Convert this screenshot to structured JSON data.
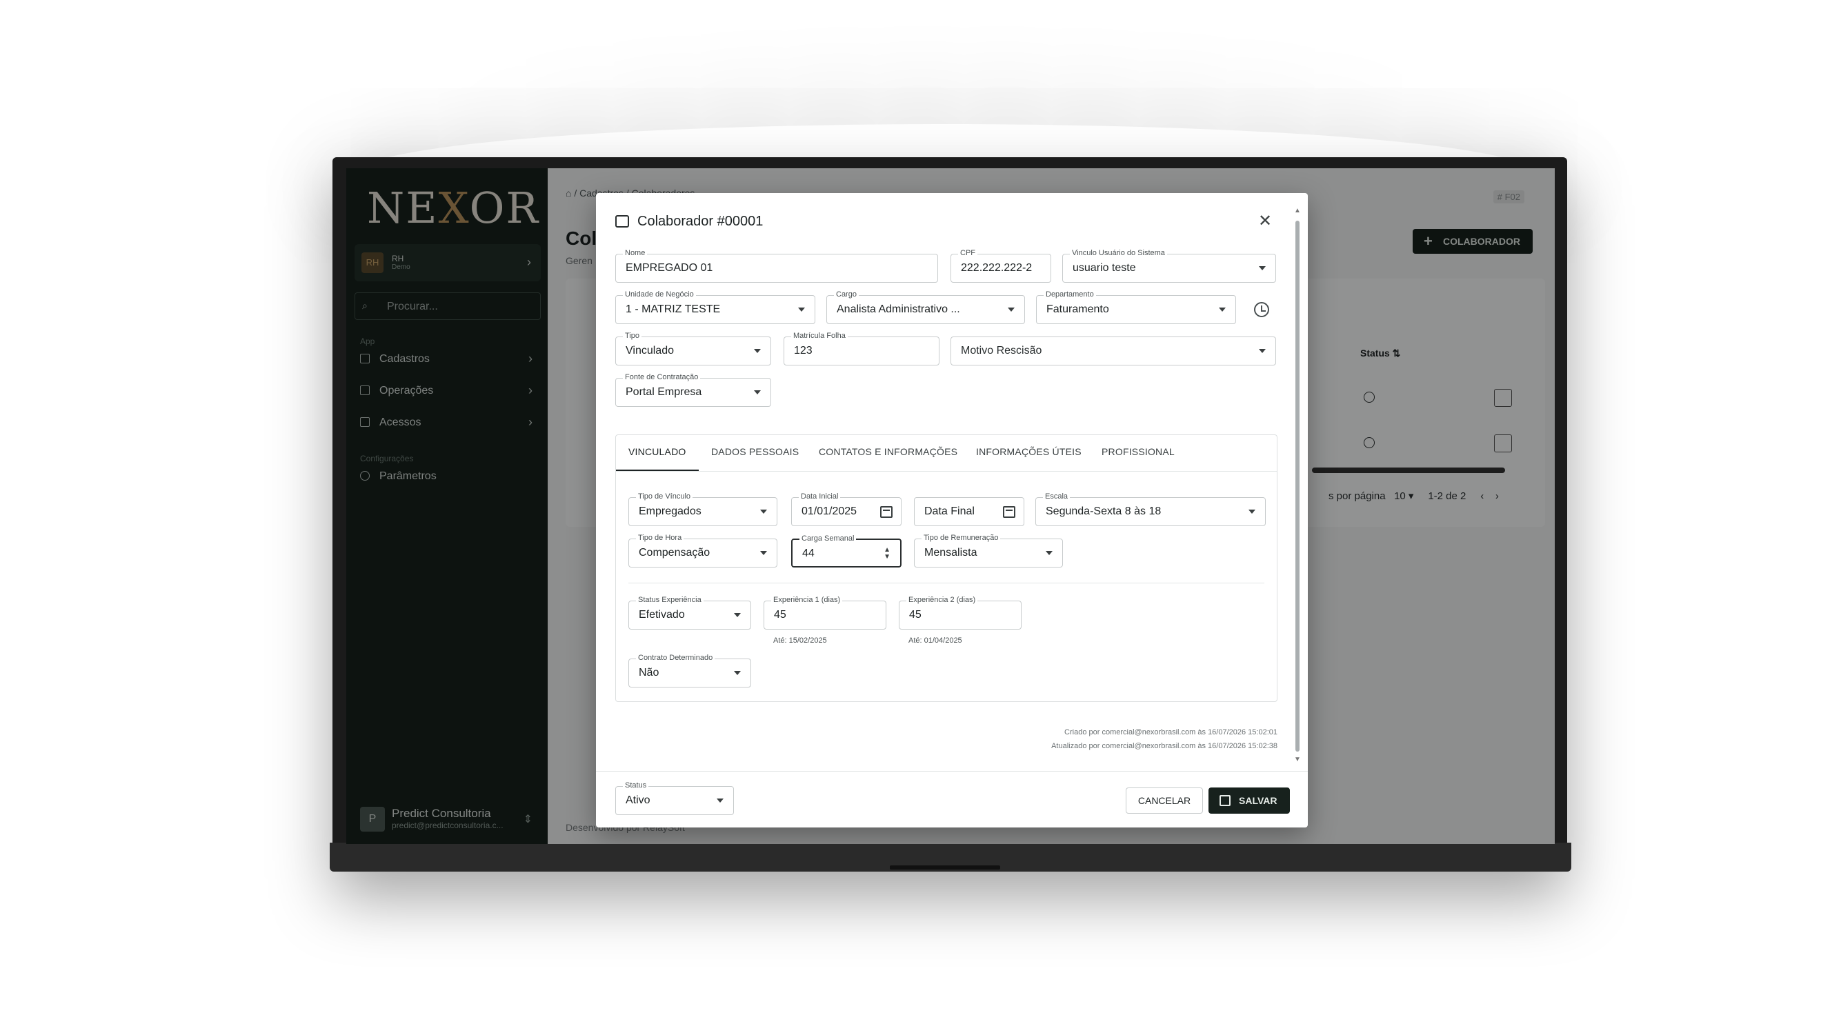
{
  "sidebar": {
    "logo": "NEXOR",
    "org": {
      "avatar": "RH",
      "name": "RH",
      "sub": "Demo"
    },
    "search_placeholder": "Procurar...",
    "section_app": "App",
    "items_app": [
      {
        "label": "Cadastros"
      },
      {
        "label": "Operações"
      },
      {
        "label": "Acessos"
      }
    ],
    "section_config": "Configurações",
    "items_config": [
      {
        "label": "Parâmetros"
      }
    ],
    "user": {
      "avatar": "P",
      "name": "Predict Consultoria",
      "email": "predict@predictconsultoria.c..."
    }
  },
  "background": {
    "breadcrumb": "⌂ /  Cadastros / Colaboradores",
    "tag": "# F02",
    "title": "Col",
    "subtitle": "Geren",
    "add_button": "COLABORADOR",
    "status_header": "Status ⇅",
    "rows_per_page_label": "s por página",
    "rows_per_page": "10",
    "range": "1-2 de 2",
    "footer": "Desenvolvido por RelaySoft"
  },
  "modal": {
    "title": "Colaborador #00001",
    "fields": {
      "nome": {
        "label": "Nome",
        "value": "EMPREGADO 01"
      },
      "cpf": {
        "label": "CPF",
        "value": "222.222.222-2"
      },
      "vinculo_usuario": {
        "label": "Vinculo Usuário do Sistema",
        "value": "usuario teste"
      },
      "unidade": {
        "label": "Unidade de Negócio",
        "value": "1 - MATRIZ TESTE"
      },
      "cargo": {
        "label": "Cargo",
        "value": "Analista Administrativo ..."
      },
      "departamento": {
        "label": "Departamento",
        "value": "Faturamento"
      },
      "tipo": {
        "label": "Tipo",
        "value": "Vinculado"
      },
      "matricula": {
        "label": "Matrícula Folha",
        "value": "123"
      },
      "motivo_rescisao": {
        "placeholder": "Motivo Rescisão"
      },
      "fonte": {
        "label": "Fonte de Contratação",
        "value": "Portal Empresa"
      }
    },
    "tabs": [
      {
        "label": "VINCULADO"
      },
      {
        "label": "DADOS PESSOAIS"
      },
      {
        "label": "CONTATOS E INFORMAÇÕES"
      },
      {
        "label": "INFORMAÇÕES ÚTEIS"
      },
      {
        "label": "PROFISSIONAL"
      }
    ],
    "vinculado": {
      "tipo_vinculo": {
        "label": "Tipo de Vínculo",
        "value": "Empregados"
      },
      "data_inicial": {
        "label": "Data Inicial",
        "value": "01/01/2025"
      },
      "data_final": {
        "placeholder": "Data Final"
      },
      "escala": {
        "label": "Escala",
        "value": "Segunda-Sexta 8 às 18"
      },
      "tipo_hora": {
        "label": "Tipo de Hora",
        "value": "Compensação"
      },
      "carga_semanal": {
        "label": "Carga Semanal",
        "value": "44"
      },
      "tipo_remuneracao": {
        "label": "Tipo de Remuneração",
        "value": "Mensalista"
      },
      "status_experiencia": {
        "label": "Status Experiência",
        "value": "Efetivado"
      },
      "experiencia1": {
        "label": "Experiência 1 (dias)",
        "value": "45",
        "helper": "Até: 15/02/2025"
      },
      "experiencia2": {
        "label": "Experiência 2 (dias)",
        "value": "45",
        "helper": "Até: 01/04/2025"
      },
      "contrato": {
        "label": "Contrato Determinado",
        "value": "Não"
      }
    },
    "audit": {
      "created": "Criado por comercial@nexorbrasil.com às 16/07/2026 15:02:01",
      "updated": "Atualizado por comercial@nexorbrasil.com às 16/07/2026 15:02:38"
    },
    "footer": {
      "status": {
        "label": "Status",
        "value": "Ativo"
      },
      "cancel": "CANCELAR",
      "save": "SALVAR"
    }
  }
}
